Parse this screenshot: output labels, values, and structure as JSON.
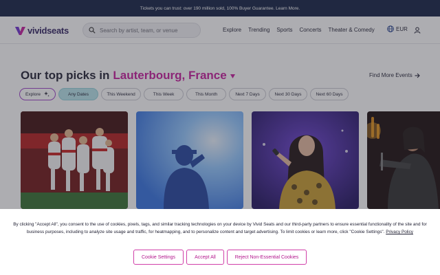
{
  "promo_bar": {
    "text": "Tickets you can trust: over 190 million sold, 100% Buyer Guarantee. Learn More."
  },
  "header": {
    "logo_text": "vividseats",
    "search": {
      "placeholder": "Search by artist, team, or venue",
      "value": ""
    },
    "nav": [
      "Explore",
      "Trending",
      "Sports",
      "Concerts",
      "Theater & Comedy"
    ],
    "currency": "EUR",
    "icons": {
      "search": "search-icon",
      "globe": "globe-icon",
      "account": "user-icon"
    }
  },
  "picks": {
    "title_prefix": "Our top picks in",
    "location": "Lauterbourg, France",
    "find_more": "Find More Events",
    "filters": [
      "Explore",
      "Any Dates",
      "This Weekend",
      "This Week",
      "This Month",
      "Next 7 Days",
      "Next 30 Days",
      "Next 60 Days"
    ],
    "active_filter": "Any Dates"
  },
  "cookie_banner": {
    "text": "By clicking \"Accept All\", you consent to the use of cookies, pixels, tags, and similar tracking technologies on your device by Vivid Seats and our third-party partners to ensure essential functionality of the site and for business purposes, including to analyze site usage and traffic, for heatmapping, and to personalize content and target advertising. To limit cookies or learn more, click \"Cookie Settings\".",
    "policy_link": "Privacy Policy",
    "buttons": {
      "settings": "Cookie Settings",
      "accept": "Accept All",
      "reject": "Reject Non-Essential Cookies"
    }
  },
  "colors": {
    "brand_navy": "#0d1b3e",
    "accent_magenta": "#c4169a",
    "chip_active": "#b5e3ea"
  }
}
